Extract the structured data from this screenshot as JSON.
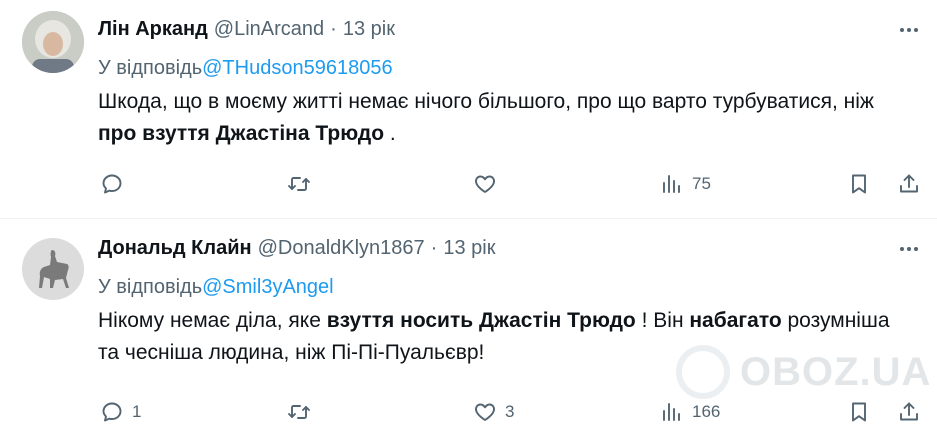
{
  "tweets": [
    {
      "name": "Лін Арканд",
      "handle": "@LinArcand",
      "separator": "·",
      "time": "13 рік",
      "reply_prefix": "У відповідь",
      "reply_to": "@THudson59618056",
      "text": {
        "part1": "Шкода, що в моєму житті немає нічого більшого, про що варто турбуватися, ніж ",
        "bold1": "про взуття Джастіна Трюдо",
        "part2": " ."
      },
      "actions": {
        "replies": "",
        "retweets": "",
        "likes": "",
        "views": "75"
      }
    },
    {
      "name": "Дональд Клайн",
      "handle": "@DonaldKlyn1867",
      "separator": "·",
      "time": "13 рік",
      "reply_prefix": "У відповідь",
      "reply_to": "@Smil3yAngel",
      "text": {
        "part1": "Нікому немає діла, яке ",
        "bold1": "взуття носить Джастін Трюдо",
        "part2": " ! Він ",
        "bold2": "набагато",
        "part3": " розумніша та чесніша людина, ніж Пі-Пі-Пуальєвр!"
      },
      "actions": {
        "replies": "1",
        "retweets": "",
        "likes": "3",
        "views": "166"
      }
    }
  ],
  "watermark": "OBOZ.UA",
  "icons": [
    "more-icon",
    "reply-icon",
    "retweet-icon",
    "like-icon",
    "views-icon",
    "bookmark-icon",
    "share-icon"
  ],
  "colors": {
    "link": "#1d9bf0",
    "secondary": "#536471",
    "text": "#0f1419",
    "divider": "#eff3f4"
  }
}
